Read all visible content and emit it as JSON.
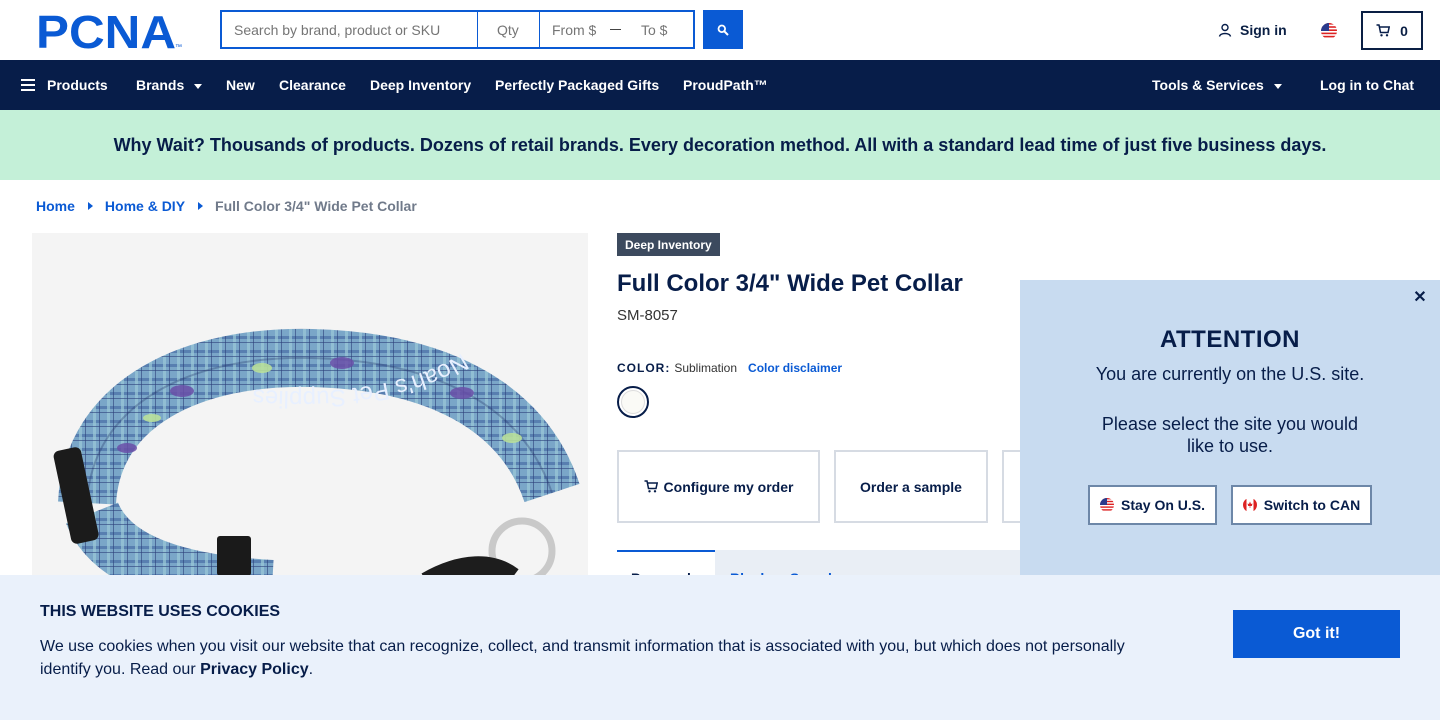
{
  "brand": {
    "logo_text": "PCNA",
    "trademark": "™"
  },
  "search": {
    "placeholder": "Search by brand, product or SKU",
    "qty_placeholder": "Qty",
    "from_placeholder": "From $",
    "to_placeholder": "To $"
  },
  "header": {
    "sign_in": "Sign in",
    "cart_count": "0"
  },
  "nav": {
    "products": "Products",
    "brands": "Brands",
    "new": "New",
    "clearance": "Clearance",
    "deep_inventory": "Deep Inventory",
    "gifts": "Perfectly Packaged Gifts",
    "proudpath": "ProudPath™",
    "tools": "Tools & Services",
    "chat": "Log in to Chat"
  },
  "promo": {
    "text": "Why Wait? Thousands of products. Dozens of retail brands. Every decoration method. All with a standard lead time of just five business days."
  },
  "breadcrumb": {
    "home": "Home",
    "category": "Home & DIY",
    "current": "Full Color 3/4\" Wide Pet Collar"
  },
  "product": {
    "badge": "Deep Inventory",
    "title": "Full Color 3/4\" Wide Pet Collar",
    "sku": "SM-8057",
    "color_label": "COLOR:",
    "color_value": "Sublimation",
    "color_disclaimer": "Color disclaimer",
    "collar_print_text": "Noah's Pet Supplies"
  },
  "actions": {
    "configure": "Configure my order",
    "sample": "Order a sample"
  },
  "tabs": {
    "active": "Proposal",
    "inactive": "Blank or Sample"
  },
  "attention": {
    "title": "ATTENTION",
    "message1": "You are currently on the U.S. site.",
    "message2": "Please select the site you would like to use.",
    "stay": "Stay On U.S.",
    "switch": "Switch to CAN"
  },
  "cookie": {
    "title": "THIS WEBSITE USES COOKIES",
    "text_before": "We use cookies when you visit our website that can recognize, collect, and transmit information that is associated with you, but which does not personally identify you. Read our ",
    "link": "Privacy Policy",
    "text_after": ".",
    "button": "Got it!"
  },
  "colors": {
    "navy": "#071d49",
    "blue": "#0a5ad4",
    "promo_green": "#c4f0d8",
    "modal_blue": "#c8dbf0",
    "cookie_bg": "#eaf1fb"
  }
}
